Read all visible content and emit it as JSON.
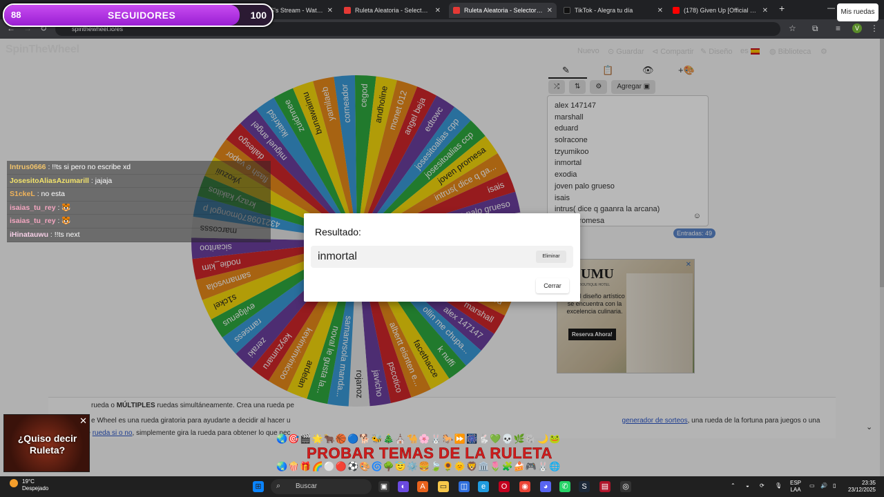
{
  "browser": {
    "tabs": [
      {
        "title": "RAVITAS's Stream - Watch Live",
        "color": "#9147ff",
        "active": false
      },
      {
        "title": "Ruleta Aleatoria - Selector Pers...",
        "color": "#e53935",
        "active": false
      },
      {
        "title": "Ruleta Aleatoria - Selector Pers...",
        "color": "#e53935",
        "active": true
      },
      {
        "title": "TikTok - Alegra tu día",
        "color": "#111111",
        "active": false
      },
      {
        "title": "(178) Given Up [Official Music V...",
        "color": "#ff0000",
        "active": false
      }
    ],
    "url": "spinthewheel.io/es",
    "profile_initial": "V"
  },
  "followers": {
    "current": "88",
    "label": "SEGUIDORES",
    "goal": "100",
    "progress": 0.88
  },
  "site": {
    "logo": "SpinTheWheel",
    "nav": [
      "Nuevo",
      "Guardar",
      "Compartir",
      "Diseño",
      "es",
      "Biblioteca"
    ],
    "my_wheels": "Mis ruedas",
    "add_button": "Agregar",
    "entries_count": "Entradas: 49"
  },
  "entries": [
    "alex 147147",
    "marshall",
    "eduard",
    "solracone",
    "tzyumikoo",
    "inmortal",
    "exodia",
    "joven palo grueso",
    "isais",
    "intrus( dice q gaanra la arcana)",
    "joven promesa"
  ],
  "chat": [
    {
      "user": "Intrus0666",
      "text": " : !!ts si pero no escribe xd",
      "color": "#f2c46d"
    },
    {
      "user": "JosesitoAliasAzumarill",
      "text": " : jajaja",
      "color": "#f3e36b"
    },
    {
      "user": "S1ckeL",
      "text": " : no esta",
      "color": "#f0b35a"
    },
    {
      "user": "isaias_tu_rey",
      "text": " : 🐯",
      "color": "#f4a6c0"
    },
    {
      "user": "isaias_tu_rey",
      "text": " : 🐯",
      "color": "#f4a6c0"
    },
    {
      "user": "iHinatauwu",
      "text": " : !!ts next",
      "color": "#f6cfe6"
    }
  ],
  "wheel": {
    "labels": [
      "corneador",
      "cegod",
      "andholine",
      "monet 012",
      "angel beja",
      "edtowc",
      "josesitoalias cpp",
      "josesitoalias ccp",
      "joven promesa",
      "intrus( dice q ga...",
      "isais",
      "joven palo grueso",
      "exodia",
      "inmortal",
      "tzyumikoo",
      "solracone",
      "eduard",
      "marshall",
      "alex 147147",
      "ollin me chupa...",
      "k nuffi",
      "facethacce",
      "albertt eisnten e...",
      "pscotico",
      "javicho",
      "rojanoz",
      "samanvsola manda...",
      "noval le gusta la...",
      "ardelan",
      "kevinvinvinicoo",
      "keyzumaru",
      "zeraki",
      "ramsess",
      "evilgenus",
      "s1ckel",
      "samanvsola",
      "nodie_kim",
      "sicaritoo",
      "marcosss",
      "432109870mongol p",
      "krazy kakitos",
      "ykozuii",
      "flash e vapor",
      "dallesgo",
      "miguel angel",
      "ikiakrisd",
      "zuidnnee",
      "bunawaimu",
      "yamilaeb"
    ],
    "colors": [
      "#3a9ad9",
      "#2eaa3f",
      "#f5d90c",
      "#e8891a",
      "#d0262a",
      "#6b3f9e",
      "#3a9ad9",
      "#2eaa3f",
      "#f5d90c",
      "#e8891a",
      "#d0262a",
      "#6b3f9e",
      "#e5e5e5"
    ]
  },
  "dialog": {
    "title": "Resultado:",
    "value": "inmortal",
    "remove": "Eliminar",
    "close": "Cerrar"
  },
  "ad": {
    "brand": "UMU",
    "sub": "BOUTIQUE HOTEL",
    "text": "nde el diseño artístico se encuentra con la excelencia culinaria.",
    "cta": "Reserva Ahora!"
  },
  "info": {
    "line1a": "rueda o ",
    "line1b": "MÚLTIPLES",
    "line1c": " ruedas simultáneamente. Crea una rueda pe",
    "line2a": "e Wheel es una rueda giratoria para ayudarte a decidir al hacer u",
    "line2link": "generador de sorteos",
    "line2b": ", una rueda de la fortuna para juegos o una",
    "line3a": "simple ",
    "line3link": "rueda si o no",
    "line3b": ", simplemente gira la rueda para obtener lo que nec"
  },
  "promo": {
    "icons": "🌏🎯🎬🌟🐂🏀🔵🐕🐝🎄⛪🐪🌸🐰🐎⏩🎆🐇💚💀🌿🐘🌙🐸",
    "icons2": "🌏🍿🎁🌈⚪🔴⚽🎨🌀🌳😇⚙️🍔🍃🌻🌞🦁🏛️🌷🧩🍰🎮🐰🌐",
    "text": "PROBAR TEMAS DE LA RULETA"
  },
  "quiso": {
    "text": "¿Quiso decir Ruleta?"
  },
  "taskbar": {
    "temp": "19°C",
    "weather": "Despejado",
    "search": "Buscar",
    "lang1": "ESP",
    "lang2": "LAA",
    "time": "23:35",
    "date": "23/12/2025"
  }
}
